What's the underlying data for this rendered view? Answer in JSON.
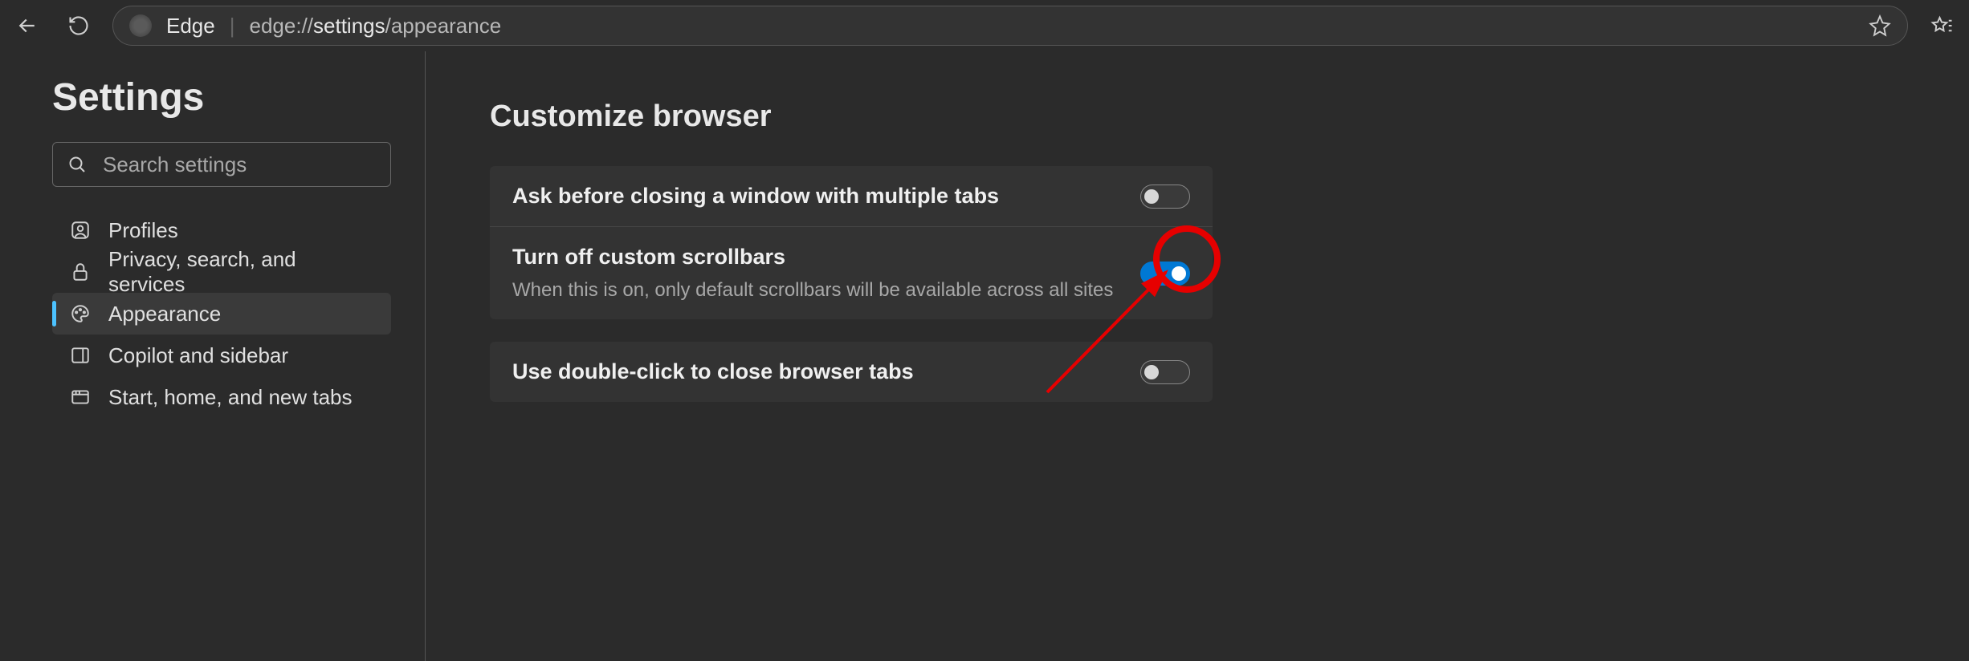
{
  "toolbar": {
    "brand": "Edge",
    "url_prefix": "edge://",
    "url_bold": "settings",
    "url_suffix": "/appearance"
  },
  "sidebar": {
    "title": "Settings",
    "search_placeholder": "Search settings",
    "items": [
      {
        "label": "Profiles"
      },
      {
        "label": "Privacy, search, and services"
      },
      {
        "label": "Appearance"
      },
      {
        "label": "Copilot and sidebar"
      },
      {
        "label": "Start, home, and new tabs"
      }
    ]
  },
  "content": {
    "section_title": "Customize browser",
    "rows": [
      {
        "title": "Ask before closing a window with multiple tabs",
        "desc": "",
        "on": false
      },
      {
        "title": "Turn off custom scrollbars",
        "desc": "When this is on, only default scrollbars will be available across all sites",
        "on": true
      },
      {
        "title": "Use double-click to close browser tabs",
        "desc": "",
        "on": false
      }
    ]
  }
}
